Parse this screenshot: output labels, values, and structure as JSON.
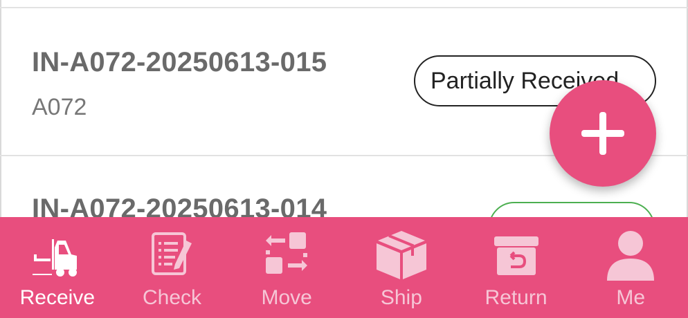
{
  "list": {
    "items": [
      {
        "order_id": "IN-A072-20250613-015",
        "supplier": "A072",
        "status": "Partially Received"
      },
      {
        "order_id": "IN-A072-20250613-014",
        "supplier": "",
        "status": ""
      }
    ]
  },
  "fab": {
    "icon": "plus-icon"
  },
  "bottom_nav": {
    "items": [
      {
        "label": "Receive",
        "icon": "forklift-icon",
        "active": true
      },
      {
        "label": "Check",
        "icon": "clipboard-icon",
        "active": false
      },
      {
        "label": "Move",
        "icon": "transfer-icon",
        "active": false
      },
      {
        "label": "Ship",
        "icon": "box-icon",
        "active": false
      },
      {
        "label": "Return",
        "icon": "return-box-icon",
        "active": false
      },
      {
        "label": "Me",
        "icon": "person-icon",
        "active": false
      }
    ]
  },
  "colors": {
    "accent": "#e84e7e",
    "partial_status_border": "#222222",
    "received_status_border": "#4caf50",
    "inactive_nav": "#f6c6d6"
  }
}
